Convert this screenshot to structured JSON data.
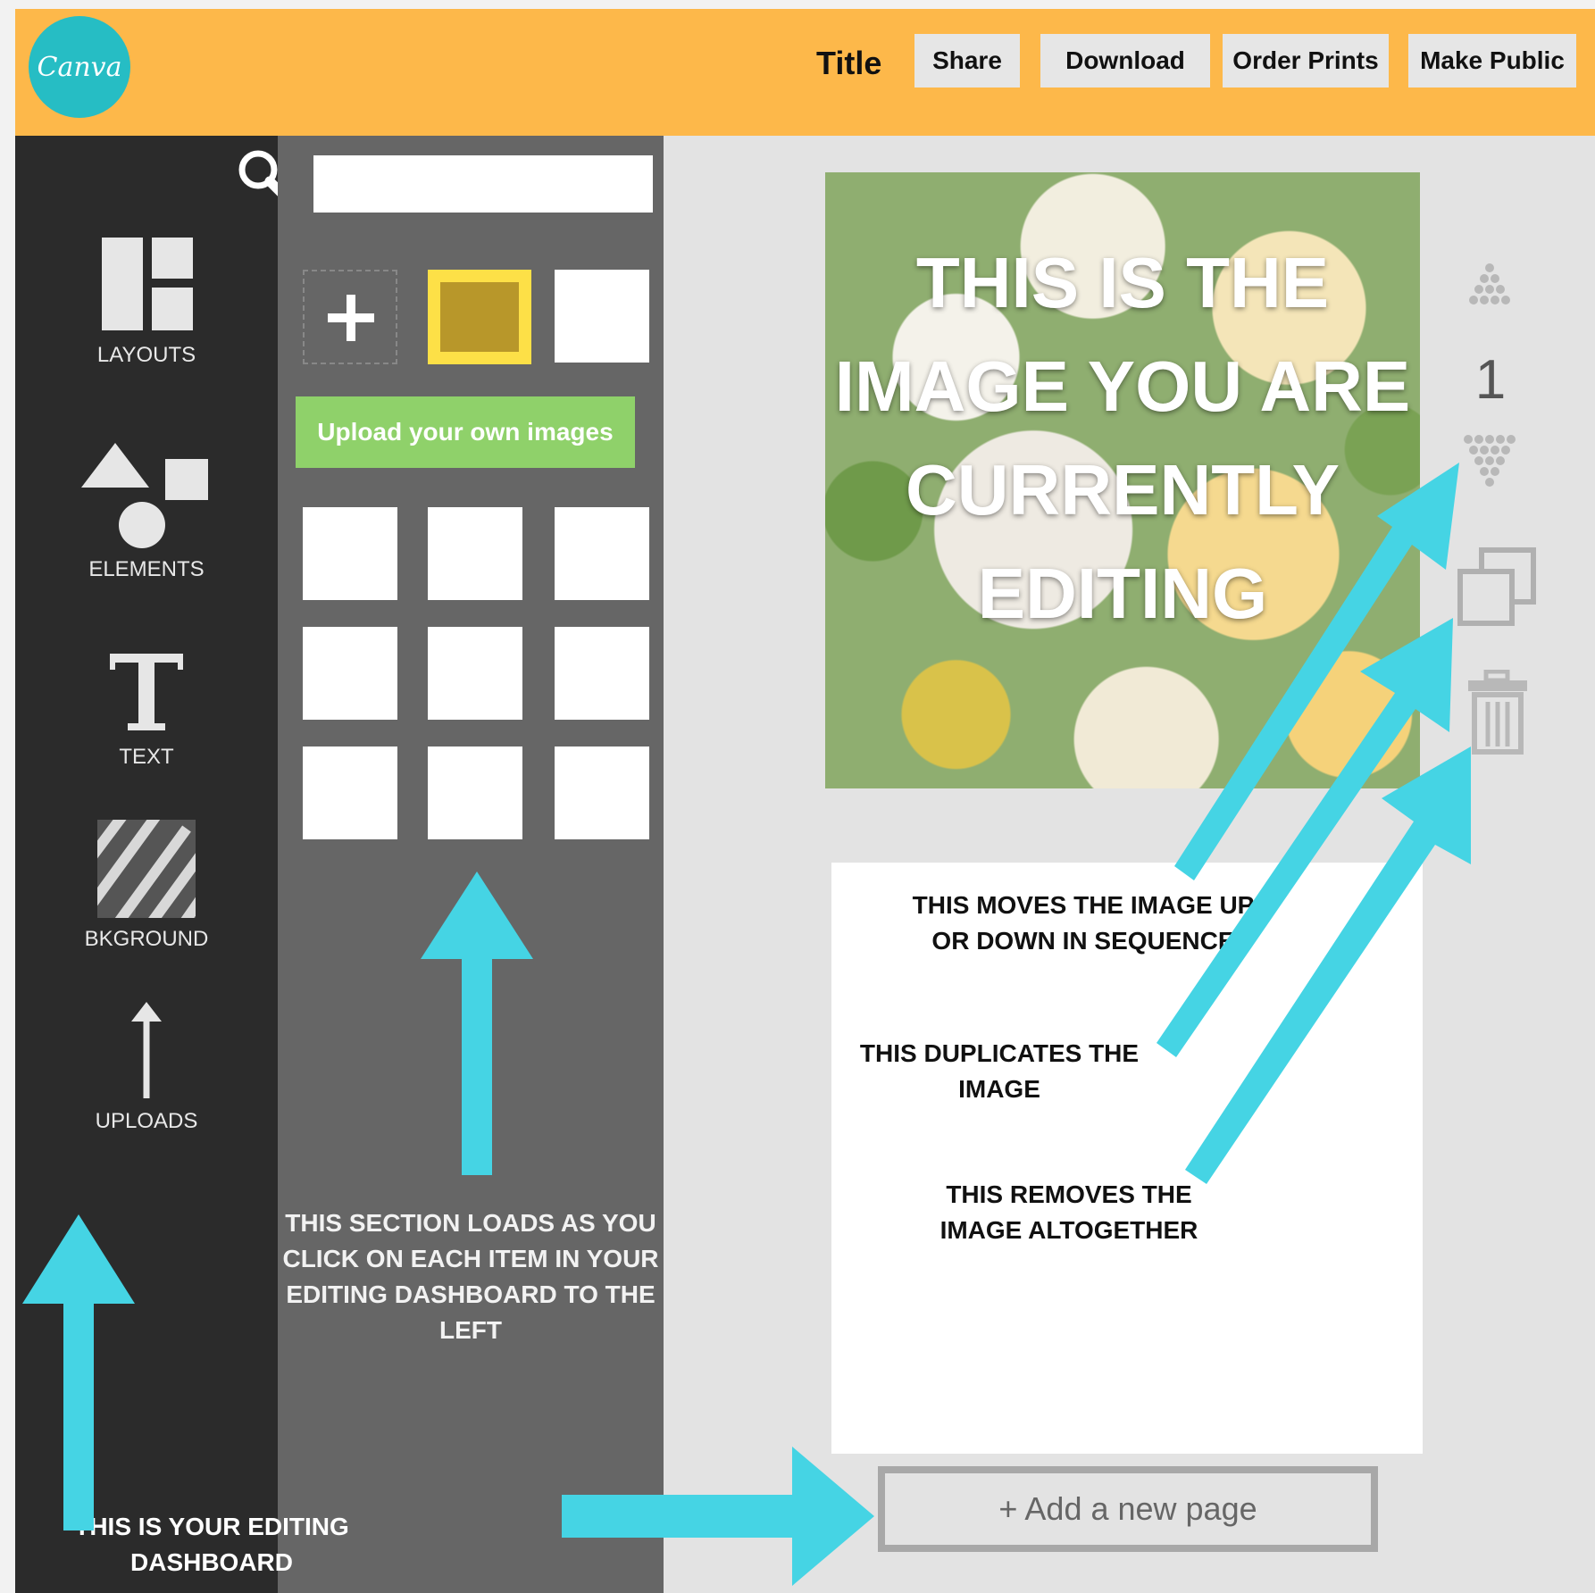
{
  "header": {
    "logo": "Canva",
    "title": "Title",
    "buttons": {
      "share": "Share",
      "download": "Download",
      "order_prints": "Order Prints",
      "make_public": "Make Public"
    }
  },
  "sidebar": {
    "items": [
      {
        "label": "LAYOUTS",
        "icon": "layouts-icon"
      },
      {
        "label": "ELEMENTS",
        "icon": "elements-icon"
      },
      {
        "label": "TEXT",
        "icon": "text-icon"
      },
      {
        "label": "BKGROUND",
        "icon": "background-icon"
      },
      {
        "label": "UPLOADS",
        "icon": "uploads-icon"
      }
    ]
  },
  "panel": {
    "search_value": "",
    "upload_label": "Upload your own images"
  },
  "canvas": {
    "image_text": "THIS IS THE IMAGE YOU ARE CURRENTLY EDITING",
    "page_number": "1"
  },
  "add_page": "+ Add a new page",
  "annotations": {
    "moves": "THIS MOVES THE IMAGE UP OR DOWN IN SEQUENCE",
    "duplicates": "THIS DUPLICATES THE IMAGE",
    "removes": "THIS REMOVES THE IMAGE ALTOGETHER",
    "section": "THIS SECTION LOADS AS YOU CLICK ON EACH ITEM IN YOUR EDITING DASHBOARD TO THE LEFT",
    "dashboard": "THIS IS YOUR EDITING DASHBOARD"
  },
  "colors": {
    "header": "#fdb84a",
    "logo": "#26bdc4",
    "sidebar": "#2b2b2b",
    "panel": "#666666",
    "upload_button": "#8fd16a",
    "selected_swatch": "#b8972a",
    "arrow": "#45d4e4"
  }
}
